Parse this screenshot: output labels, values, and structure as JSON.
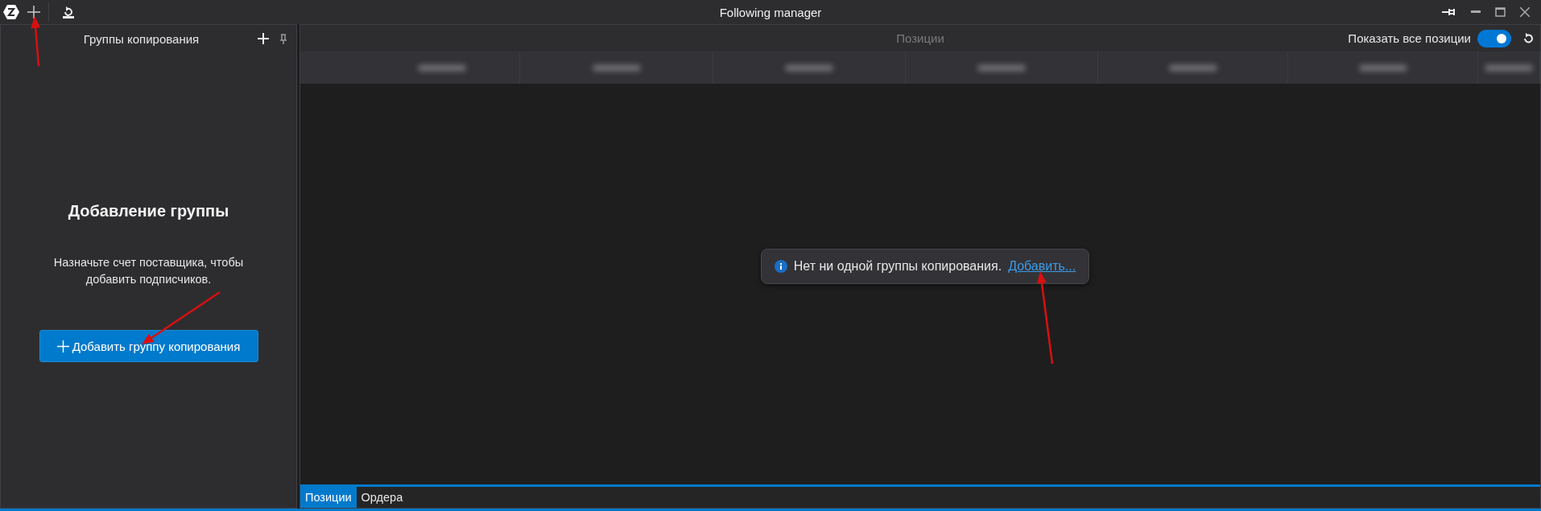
{
  "window": {
    "title": "Following manager"
  },
  "groups_panel": {
    "title": "Группы копирования",
    "heading": "Добавление группы",
    "description": "Назначьте счет поставщика, чтобы добавить подписчиков.",
    "button": "Добавить группу копирования"
  },
  "positions_panel": {
    "title": "Позиции",
    "show_all": {
      "label": "Показать все позиции",
      "on": true
    },
    "notice": {
      "text": "Нет ни одной группы копирования.",
      "link": "Добавить..."
    }
  },
  "bottom_tabs": [
    {
      "label": "Позиции",
      "selected": true
    },
    {
      "label": "Ордера",
      "selected": false
    }
  ]
}
